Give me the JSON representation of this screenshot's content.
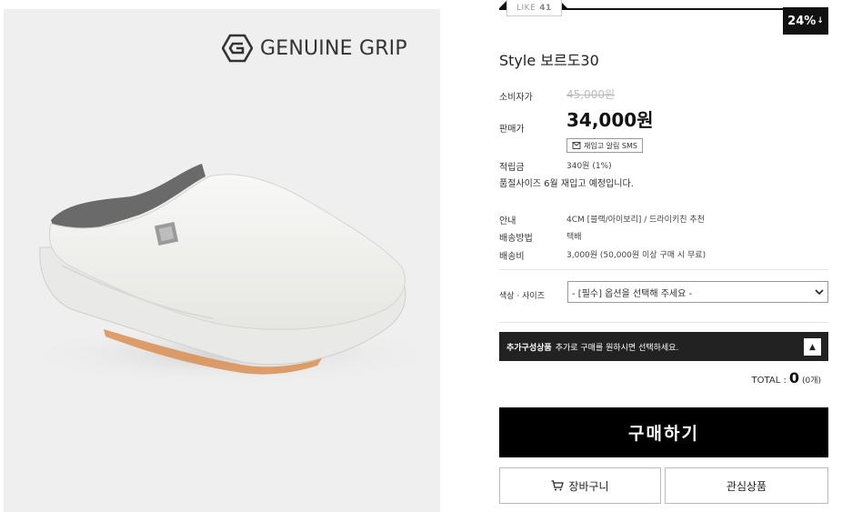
{
  "brand": {
    "name": "GENUINE GRIP"
  },
  "like": {
    "label": "LIKE",
    "count": "41"
  },
  "discount": {
    "percent": "24%",
    "arrow": "↓"
  },
  "product": {
    "title": "Style 보르도30",
    "consumer_price_label": "소비자가",
    "consumer_price": "45,000원",
    "sale_price_label": "판매가",
    "sale_price": "34,000원",
    "sms_button": "재입고 알림 SMS",
    "points_label": "적립금",
    "points_value": "340원 (1%)",
    "soldout_notice": "품절사이즈 6월 재입고 예정입니다.",
    "guide_label": "안내",
    "guide_value": "4CM [블랙/아이보리] / 드라이키친 추천",
    "shipping_method_label": "배송방법",
    "shipping_method_value": "택배",
    "shipping_fee_label": "배송비",
    "shipping_fee_value": "3,000원 (50,000원 이상 구매 시 무료)"
  },
  "option": {
    "label": "색상 · 사이즈",
    "selected": "- [필수] 옵션을 선택해 주세요 -"
  },
  "addon": {
    "title": "추가구성상품",
    "description": "추가로 구매를 원하시면 선택하세요.",
    "toggle_icon": "▲"
  },
  "total": {
    "label": "TOTAL :",
    "amount": "0",
    "count": "(0개)"
  },
  "buttons": {
    "buy": "구매하기",
    "cart": "장바구니",
    "wishlist": "관심상품"
  },
  "colors": {
    "accent": "#000000",
    "panel_bg": "#efefef"
  }
}
